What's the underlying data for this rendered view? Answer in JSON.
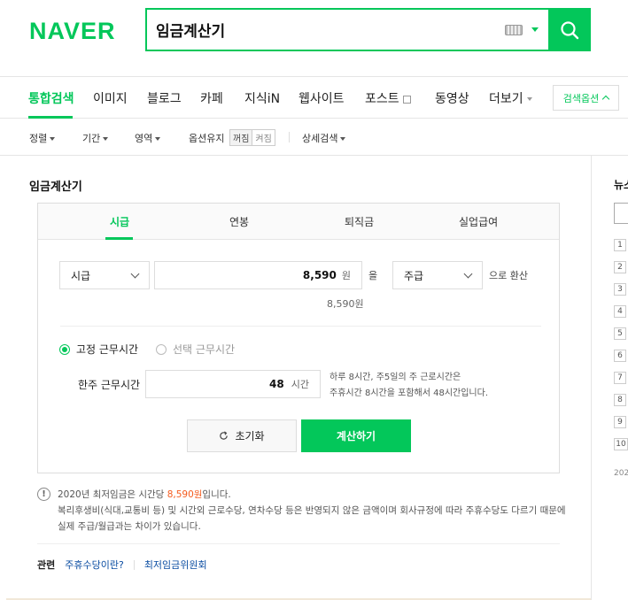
{
  "header": {
    "logo": "NAVER",
    "query": "임금계산기"
  },
  "nav": {
    "tabs": [
      "통합검색",
      "이미지",
      "블로그",
      "카페",
      "지식iN",
      "웹사이트",
      "포스트",
      "동영상",
      "더보기"
    ],
    "options_label": "검색옵션"
  },
  "filters": {
    "sort": "정렬",
    "period": "기간",
    "area": "영역",
    "keep_option": "옵션유지",
    "toggle_off": "꺼짐",
    "toggle_on": "켜짐",
    "detail": "상세검색"
  },
  "calculator": {
    "title": "임금계산기",
    "tabs": [
      "시급",
      "연봉",
      "퇴직금",
      "실업급여"
    ],
    "from_unit": "시급",
    "amount": "8,590",
    "amount_unit": "원",
    "particle": "을",
    "to_unit": "주급",
    "convert_label": "으로 환산",
    "amount_readout": "8,590원",
    "radio_fixed": "고정 근무시간",
    "radio_select": "선택 근무시간",
    "weekly_hours_label": "한주 근무시간",
    "weekly_hours": "48",
    "hours_unit": "시간",
    "hint_line1": "하루 8시간, 주5일의 주 근로시간은",
    "hint_line2": "주휴시간 8시간을 포함해서 48시간입니다.",
    "reset_label": "초기화",
    "calc_label": "계산하기"
  },
  "note": {
    "line1_prefix": "2020년 최저임금은 시간당 ",
    "line1_highlight": "8,590원",
    "line1_suffix": "입니다.",
    "line2": "복리후생비(식대,교통비 등) 및 시간외 근로수당, 연차수당 등은 반영되지 않은 금액이며 회사규정에 따라 주휴수당도 다르기 때문에",
    "line3": "실제 주급/월급과는 차이가 있습니다."
  },
  "related": {
    "label": "관련",
    "links": [
      "주휴수당이란?",
      "최저임금위원회"
    ]
  },
  "sidebar": {
    "title": "뉴스",
    "ranks": [
      "1",
      "2",
      "3",
      "4",
      "5",
      "6",
      "7",
      "8",
      "9",
      "10"
    ],
    "footer": "202"
  },
  "colors": {
    "brand": "#03c75a",
    "highlight": "#f45b1e",
    "link": "#0b4da2"
  }
}
